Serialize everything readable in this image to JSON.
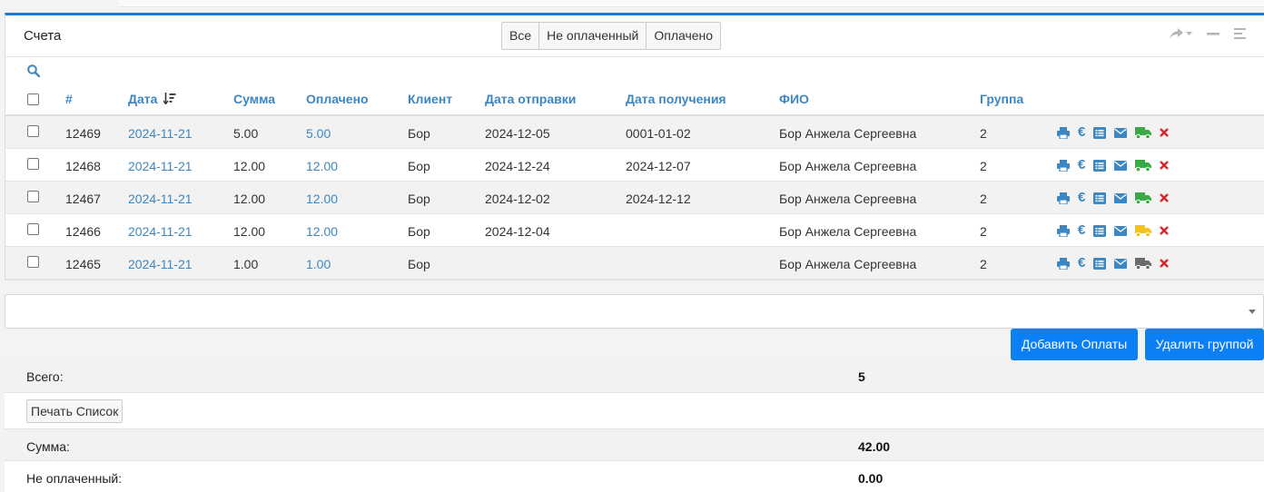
{
  "panel": {
    "title": "Счета",
    "filters": [
      "Все",
      "Не оплаченный",
      "Оплачено"
    ]
  },
  "table": {
    "headers": {
      "num": "#",
      "date": "Дата",
      "sum": "Сумма",
      "paid": "Оплачено",
      "client": "Клиент",
      "sent_date": "Дата отправки",
      "received_date": "Дата получения",
      "fio": "ФИО",
      "group": "Группа"
    },
    "rows": [
      {
        "num": "12469",
        "date": "2024-11-21",
        "sum": "5.00",
        "paid": "5.00",
        "client": "Бор",
        "sent_date": "2024-12-05",
        "received_date": "0001-01-02",
        "fio": "Бор Анжела Сергеевна",
        "group": "2",
        "truck_color": "#3aa845"
      },
      {
        "num": "12468",
        "date": "2024-11-21",
        "sum": "12.00",
        "paid": "12.00",
        "client": "Бор",
        "sent_date": "2024-12-24",
        "received_date": "2024-12-07",
        "fio": "Бор Анжела Сергеевна",
        "group": "2",
        "truck_color": "#3aa845"
      },
      {
        "num": "12467",
        "date": "2024-11-21",
        "sum": "12.00",
        "paid": "12.00",
        "client": "Бор",
        "sent_date": "2024-12-02",
        "received_date": "2024-12-12",
        "fio": "Бор Анжела Сергеевна",
        "group": "2",
        "truck_color": "#3aa845"
      },
      {
        "num": "12466",
        "date": "2024-11-21",
        "sum": "12.00",
        "paid": "12.00",
        "client": "Бор",
        "sent_date": "2024-12-04",
        "received_date": "",
        "fio": "Бор Анжела Сергеевна",
        "group": "2",
        "truck_color": "#f5c21b"
      },
      {
        "num": "12465",
        "date": "2024-11-21",
        "sum": "1.00",
        "paid": "1.00",
        "client": "Бор",
        "sent_date": "",
        "received_date": "",
        "fio": "Бор Анжела Сергеевна",
        "group": "2",
        "truck_color": "#6b6b6b"
      }
    ]
  },
  "buttons": {
    "add_payments": "Добавить Оплаты",
    "delete_group": "Удалить группой",
    "print_list": "Печать Список"
  },
  "summary": {
    "total_label": "Всего:",
    "total_value": "5",
    "sum_label": "Сумма:",
    "sum_value": "42.00",
    "unpaid_label": "Не оплаченный:",
    "unpaid_value": "0.00"
  },
  "colors": {
    "accent": "#1a7ad6",
    "link": "#3c87c1",
    "primary_button": "#0d7ff5",
    "delete_icon": "#d9232e"
  }
}
